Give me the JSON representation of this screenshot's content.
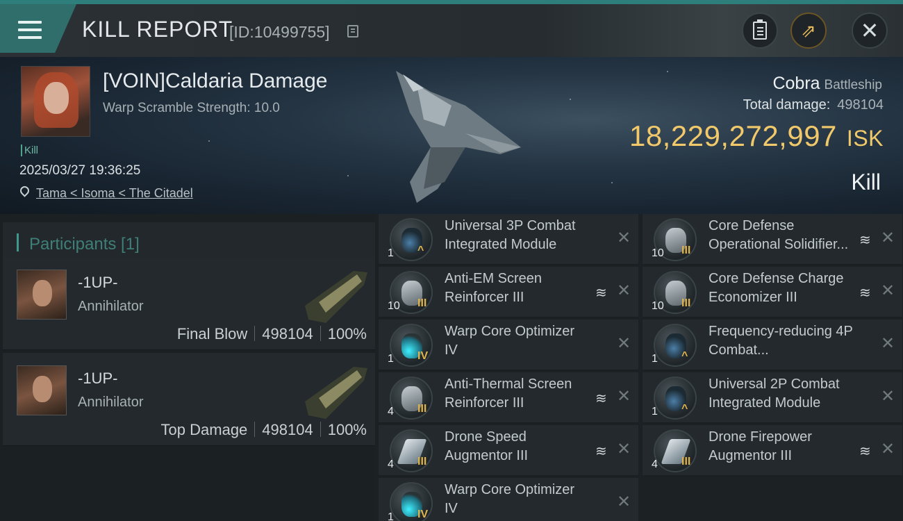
{
  "header": {
    "title": "KILL REPORT",
    "report_id": "[ID:10499755]"
  },
  "victim": {
    "name": "[VOIN]Caldaria Damage",
    "scramble": "Warp Scramble Strength: 10.0",
    "tag": "Kill",
    "datetime": "2025/03/27 19:36:25",
    "location": "Tama < Isoma < The Citadel"
  },
  "ship": {
    "name": "Cobra",
    "class": "Battleship",
    "total_damage_label": "Total damage:",
    "total_damage": "498104",
    "isk_value": "18,229,272,997",
    "isk_unit": "ISK",
    "result": "Kill"
  },
  "participants": {
    "title": "Participants [1]",
    "rows": [
      {
        "name": "-1UP-",
        "ship": "Annihilator",
        "role": "Final Blow",
        "damage": "498104",
        "pct": "100%"
      },
      {
        "name": "-1UP-",
        "ship": "Annihilator",
        "role": "Top Damage",
        "damage": "498104",
        "pct": "100%"
      }
    ]
  },
  "modules": {
    "left": [
      {
        "name": "Universal 3P Combat Integrated Module",
        "qty": "1",
        "tier": "^",
        "icon": "integrated-module-icon",
        "stack": false
      },
      {
        "name": "Anti-EM Screen Reinforcer III",
        "qty": "10",
        "tier": "III",
        "icon": "shield-reinforcer-icon",
        "stack": true
      },
      {
        "name": "Warp Core Optimizer IV",
        "qty": "1",
        "tier": "IV",
        "icon": "warp-core-optimizer-icon",
        "stack": false
      },
      {
        "name": "Anti-Thermal Screen Reinforcer III",
        "qty": "4",
        "tier": "III",
        "icon": "shield-reinforcer-icon",
        "stack": true
      },
      {
        "name": "Drone Speed Augmentor III",
        "qty": "4",
        "tier": "III",
        "icon": "drone-augmentor-icon",
        "stack": true
      },
      {
        "name": "Warp Core Optimizer IV",
        "qty": "1",
        "tier": "IV",
        "icon": "warp-core-optimizer-icon",
        "stack": false
      }
    ],
    "right": [
      {
        "name": "Core Defense Operational Solidifier...",
        "qty": "10",
        "tier": "III",
        "icon": "shield-reinforcer-icon",
        "stack": true
      },
      {
        "name": "Core Defense Charge Economizer III",
        "qty": "10",
        "tier": "III",
        "icon": "shield-reinforcer-icon",
        "stack": true
      },
      {
        "name": "Frequency-reducing 4P Combat...",
        "qty": "1",
        "tier": "^",
        "icon": "integrated-module-icon",
        "stack": false
      },
      {
        "name": "Universal 2P Combat Integrated Module",
        "qty": "1",
        "tier": "^",
        "icon": "integrated-module-icon",
        "stack": false
      },
      {
        "name": "Drone Firepower Augmentor III",
        "qty": "4",
        "tier": "III",
        "icon": "drone-augmentor-icon",
        "stack": true
      }
    ]
  },
  "colors": {
    "accent": "#2e7f7c",
    "isk": "#f1c96a",
    "tier": "#e0b44c"
  }
}
